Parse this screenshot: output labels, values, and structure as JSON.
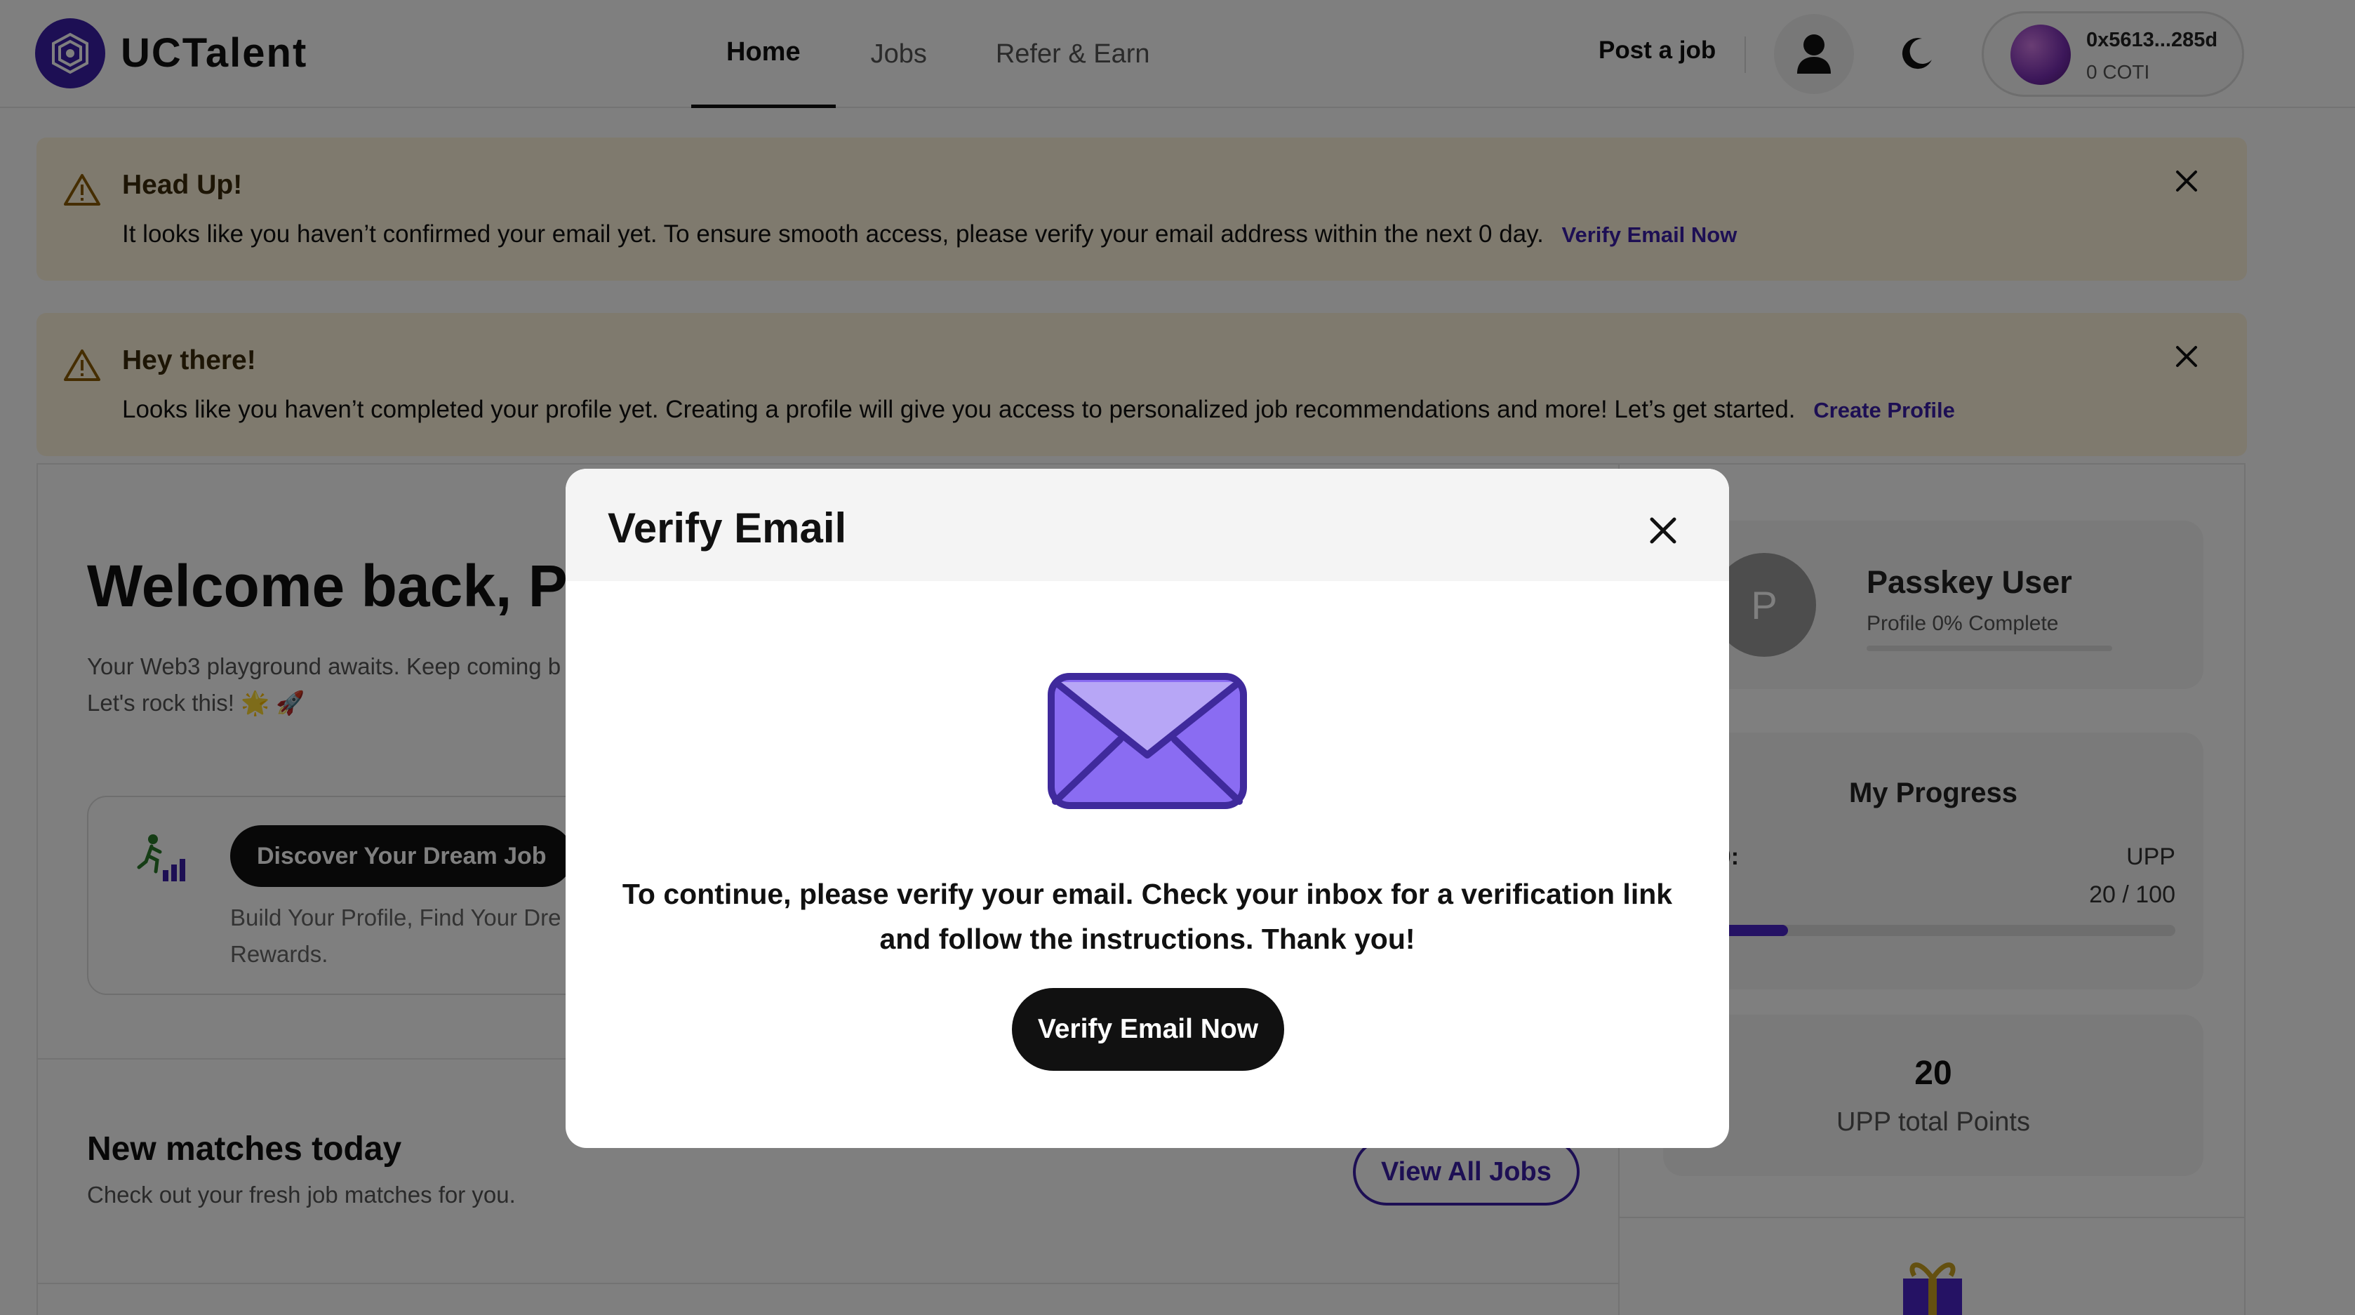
{
  "header": {
    "brand": "UCTalent",
    "nav": [
      {
        "label": "Home",
        "active": true
      },
      {
        "label": "Jobs",
        "active": false
      },
      {
        "label": "Refer & Earn",
        "active": false
      }
    ],
    "post_job_label": "Post a job",
    "wallet": {
      "address": "0x5613...285d",
      "balance": "0 COTI"
    }
  },
  "alerts": [
    {
      "title": "Head Up!",
      "message": "It looks like you haven’t confirmed your email yet. To ensure smooth access, please verify your email address within the next 0 day.",
      "link": "Verify Email Now"
    },
    {
      "title": "Hey there!",
      "message": "Looks like you haven’t completed your profile yet. Creating a profile will give you access to personalized job recommendations and more! Let’s get started.",
      "link": "Create Profile"
    }
  ],
  "main": {
    "welcome": "Welcome back, Pas",
    "welcome_sub": "Your Web3 playground awaits. Keep coming b possibilities. Let's rock this! 🌟 🚀",
    "discover_button": "Discover Your Dream Job",
    "discover_sub": "Build Your Profile, Find Your Dre Crypto Rewards.",
    "matches_title": "New matches today",
    "matches_sub": "Check out your fresh job matches for you.",
    "view_all": "View All Jobs"
  },
  "sidebar": {
    "avatar_initial": "P",
    "name": "Passkey User",
    "profile_complete": "Profile 0% Complete",
    "progress_title": "My Progress",
    "level_label": "el 0:",
    "level_right": "UPP",
    "level2_label": "er",
    "level2_right": "20 / 100",
    "level_progress": 0.2,
    "points": "20",
    "points_label": "UPP total Points"
  },
  "modal": {
    "title": "Verify Email",
    "message": "To continue, please verify your email. Check your inbox for a verification link and follow the instructions. Thank you!",
    "button": "Verify Email Now"
  },
  "colors": {
    "accent": "#3b1fa8",
    "alert_bg": "#fff4dc",
    "envelope": "#8a6cf2",
    "overlay": "rgba(0,0,0,0.5)"
  }
}
